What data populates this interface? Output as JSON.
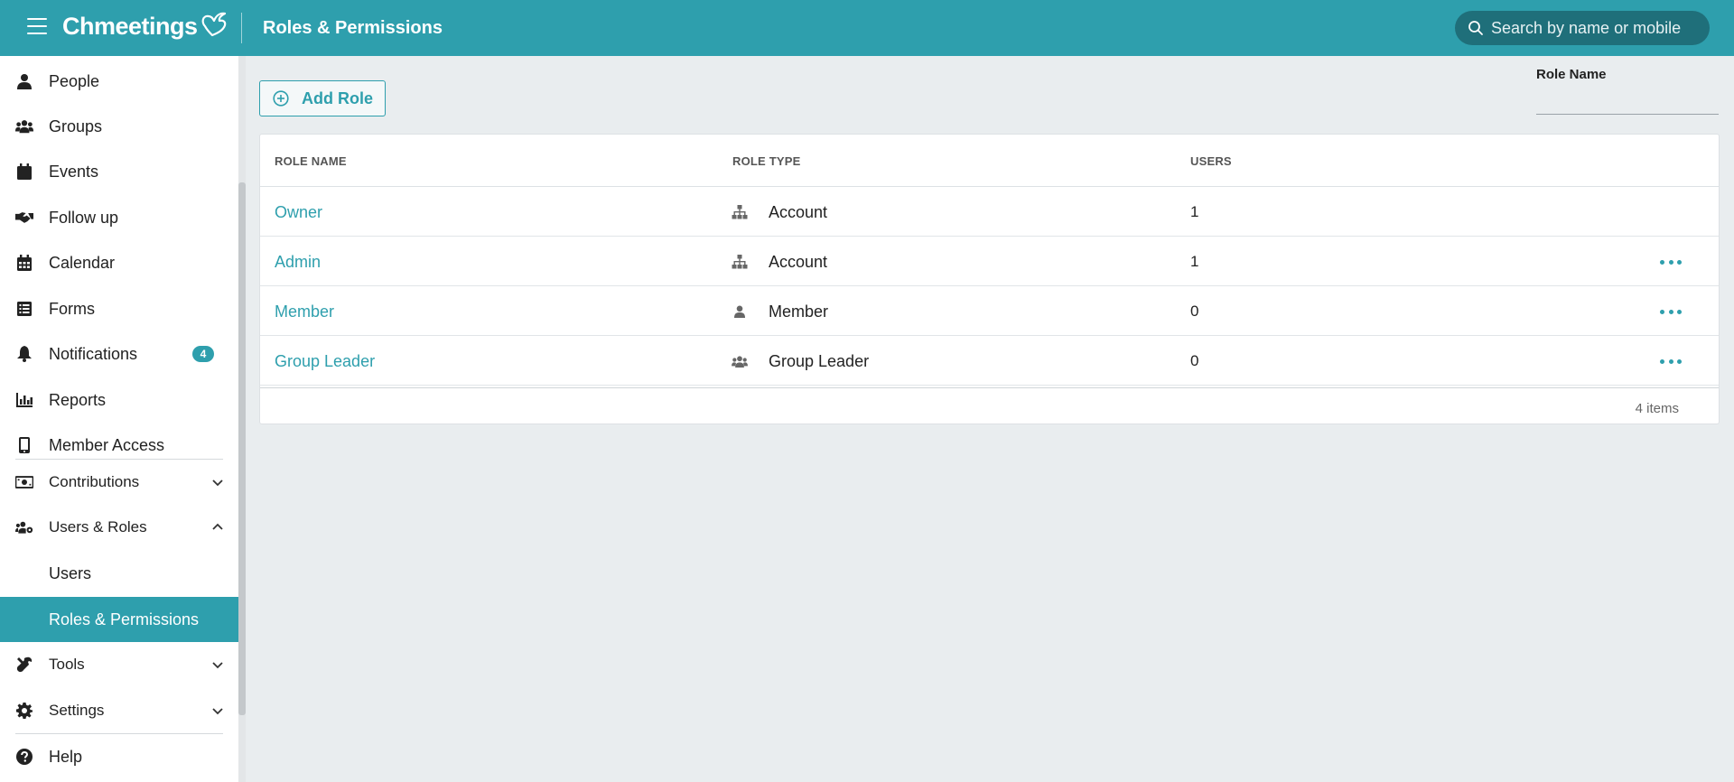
{
  "header": {
    "brand": "Chmeetings",
    "title": "Roles & Permissions",
    "search_placeholder": "Search by name or mobile"
  },
  "sidebar": {
    "items": [
      {
        "label": "People",
        "icon": "person-icon"
      },
      {
        "label": "Groups",
        "icon": "users-icon"
      },
      {
        "label": "Events",
        "icon": "calendar-icon"
      },
      {
        "label": "Follow up",
        "icon": "handshake-icon"
      },
      {
        "label": "Calendar",
        "icon": "calendar-grid-icon"
      },
      {
        "label": "Forms",
        "icon": "list-icon"
      },
      {
        "label": "Notifications",
        "icon": "bell-icon",
        "badge": "4"
      },
      {
        "label": "Reports",
        "icon": "bar-chart-icon"
      },
      {
        "label": "Member Access",
        "icon": "mobile-icon"
      },
      {
        "label": "Contributions",
        "icon": "money-icon"
      },
      {
        "label": "Users & Roles",
        "icon": "users-cog-icon"
      },
      {
        "label": "Users"
      },
      {
        "label": "Roles & Permissions"
      },
      {
        "label": "Tools",
        "icon": "tools-icon"
      },
      {
        "label": "Settings",
        "icon": "gear-icon"
      },
      {
        "label": "Help",
        "icon": "question-icon"
      }
    ]
  },
  "toolbar": {
    "add_role_label": "Add Role"
  },
  "filter": {
    "label": "Role Name",
    "value": ""
  },
  "table": {
    "columns": [
      "ROLE NAME",
      "ROLE TYPE",
      "USERS"
    ],
    "rows": [
      {
        "name": "Owner",
        "type": "Account",
        "type_icon": "sitemap-icon",
        "users": "1"
      },
      {
        "name": "Admin",
        "type": "Account",
        "type_icon": "sitemap-icon",
        "users": "1"
      },
      {
        "name": "Member",
        "type": "Member",
        "type_icon": "person-icon",
        "users": "0"
      },
      {
        "name": "Group Leader",
        "type": "Group Leader",
        "type_icon": "users-icon",
        "users": "0"
      }
    ],
    "footer": "4 items"
  },
  "colors": {
    "accent": "#2e9fad",
    "search_bg": "#1f6f7a",
    "page_bg": "#e9edef"
  }
}
